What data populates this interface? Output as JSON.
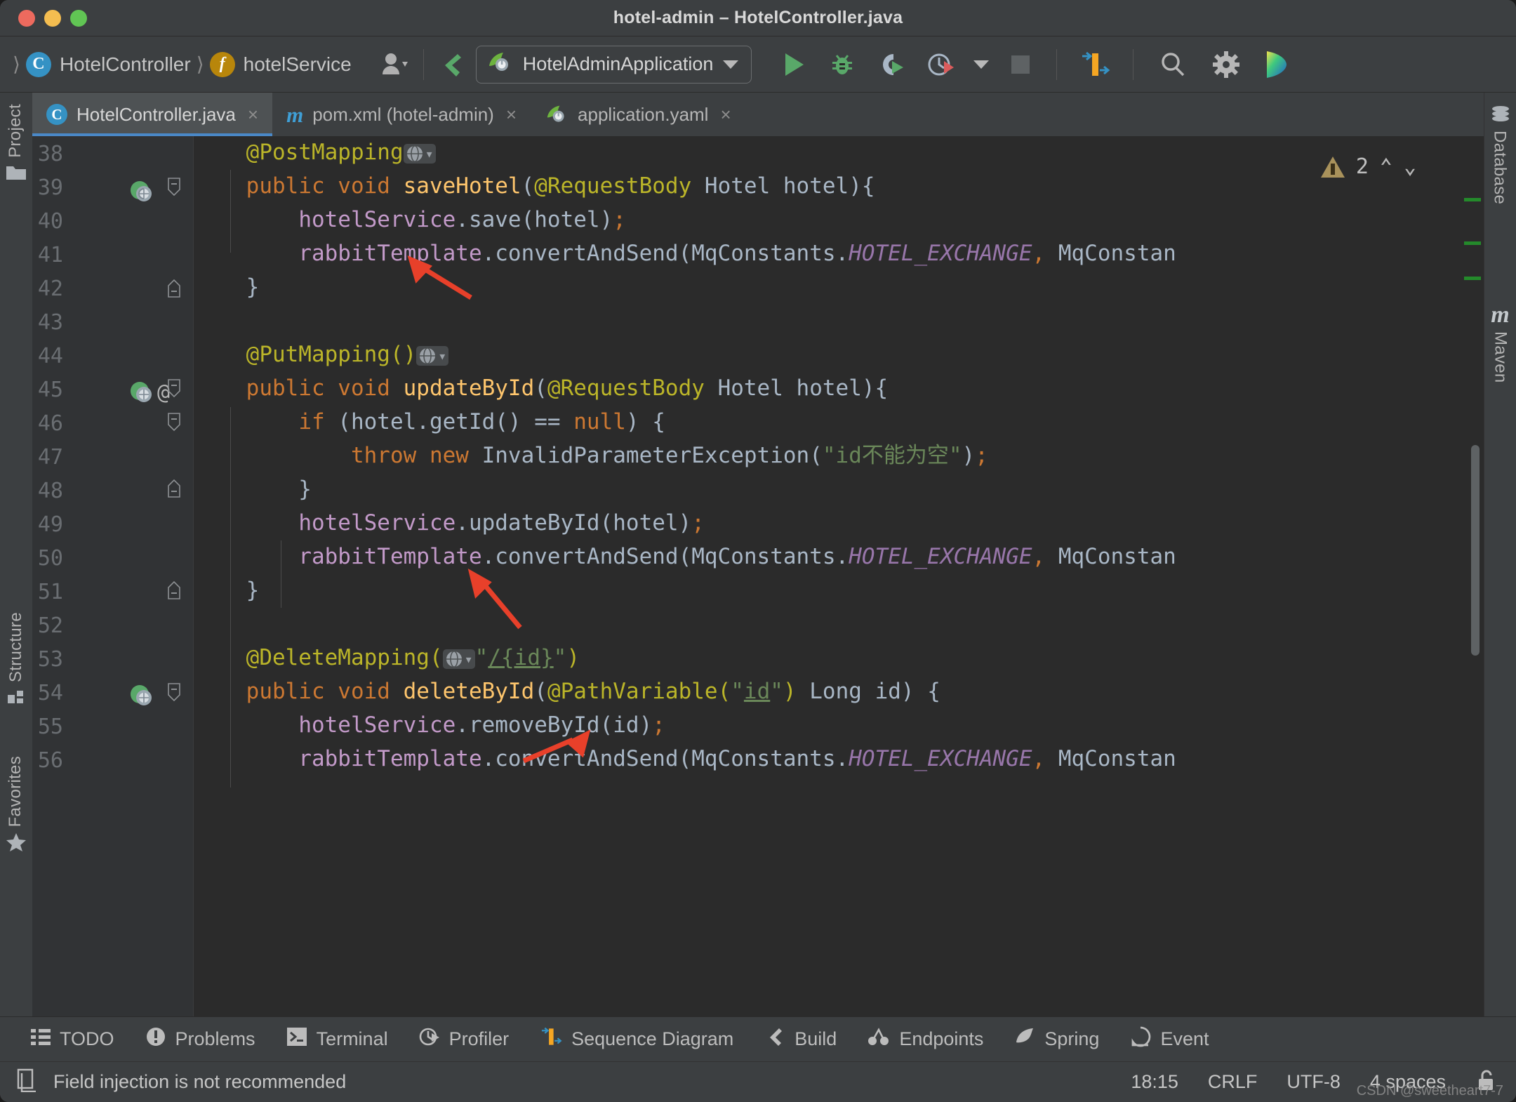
{
  "window": {
    "title": "hotel-admin – HotelController.java",
    "traffic": [
      "close",
      "minimize",
      "zoom"
    ]
  },
  "toolbar": {
    "breadcrumbs": [
      {
        "icon": "class-icon",
        "badge": "C",
        "label": "HotelController"
      },
      {
        "icon": "field-icon",
        "badge": "f",
        "label": "hotelService"
      }
    ],
    "profile_icon": "user-profile-icon",
    "update_icon": "vcs-update-icon",
    "run_config": {
      "icon": "spring-boot-icon",
      "label": "HotelAdminApplication"
    },
    "actions": [
      {
        "name": "run-button",
        "icon": "run-icon"
      },
      {
        "name": "debug-button",
        "icon": "debug-icon"
      },
      {
        "name": "run-coverage-button",
        "icon": "coverage-icon"
      },
      {
        "name": "profile-button",
        "icon": "profiler-icon"
      },
      {
        "name": "stop-button",
        "icon": "stop-icon"
      },
      {
        "name": "sequence-diagram-button",
        "icon": "sequence-diagram-icon"
      },
      {
        "name": "search-everywhere-button",
        "icon": "search-icon"
      },
      {
        "name": "settings-button",
        "icon": "gear-icon"
      },
      {
        "name": "ai-assistant-button",
        "icon": "ai-assistant-icon"
      }
    ]
  },
  "tabs": [
    {
      "label": "HotelController.java",
      "icon": "java-class-icon",
      "active": true,
      "close": "×"
    },
    {
      "label": "pom.xml (hotel-admin)",
      "icon": "maven-icon",
      "active": false,
      "close": "×"
    },
    {
      "label": "application.yaml",
      "icon": "spring-yaml-icon",
      "active": false,
      "close": "×"
    }
  ],
  "left_stripe": [
    {
      "label": "Project",
      "icon": "project-folder-icon"
    },
    {
      "label": "Structure",
      "icon": "structure-icon"
    },
    {
      "label": "Favorites",
      "icon": "star-icon"
    }
  ],
  "right_stripe": [
    {
      "label": "Database",
      "icon": "database-icon"
    },
    {
      "label": "Maven",
      "icon": "maven-m-icon"
    }
  ],
  "editor": {
    "inspection": {
      "count": "2",
      "icon": "warning-triangle-icon",
      "prev": "⌃",
      "next": "⌄"
    },
    "line_numbers": [
      "38",
      "39",
      "40",
      "41",
      "42",
      "43",
      "44",
      "45",
      "46",
      "47",
      "48",
      "49",
      "50",
      "51",
      "52",
      "53",
      "54",
      "55",
      "56"
    ],
    "gutter_icons": [
      {
        "line": "39",
        "icon": "spring-endpoint-icon"
      },
      {
        "line": "45",
        "icon": "spring-endpoint-icon"
      },
      {
        "line": "45",
        "icon": "annotation-at-icon",
        "glyph": "@"
      },
      {
        "line": "54",
        "icon": "spring-endpoint-icon"
      }
    ],
    "code_lines": [
      {
        "n": "38",
        "tokens": [
          {
            "t": "    @PostMapping",
            "c": "anno"
          },
          {
            "t": "GLOBE",
            "c": "globe"
          }
        ]
      },
      {
        "n": "39",
        "tokens": [
          {
            "t": "    ",
            "c": "punct"
          },
          {
            "t": "public void ",
            "c": "kw"
          },
          {
            "t": "saveHotel",
            "c": "meth"
          },
          {
            "t": "(",
            "c": "punct"
          },
          {
            "t": "@RequestBody",
            "c": "anno"
          },
          {
            "t": " Hotel hotel)",
            "c": "ident"
          },
          {
            "t": "{",
            "c": "punct"
          }
        ]
      },
      {
        "n": "40",
        "tokens": [
          {
            "t": "        ",
            "c": "punct"
          },
          {
            "t": "hotelService",
            "c": "field"
          },
          {
            "t": ".save(hotel)",
            "c": "ident"
          },
          {
            "t": ";",
            "c": "semi"
          }
        ]
      },
      {
        "n": "41",
        "tokens": [
          {
            "t": "        ",
            "c": "punct"
          },
          {
            "t": "rabbitTemplate",
            "c": "field"
          },
          {
            "t": ".convertAndSend(MqConstants.",
            "c": "ident"
          },
          {
            "t": "HOTEL_EXCHANGE",
            "c": "stat"
          },
          {
            "t": ",",
            "c": "semi"
          },
          {
            "t": " MqConstan",
            "c": "ident"
          }
        ]
      },
      {
        "n": "42",
        "tokens": [
          {
            "t": "    }",
            "c": "punct"
          }
        ]
      },
      {
        "n": "43",
        "tokens": []
      },
      {
        "n": "44",
        "tokens": [
          {
            "t": "    @PutMapping()",
            "c": "anno"
          },
          {
            "t": "GLOBE",
            "c": "globe"
          }
        ]
      },
      {
        "n": "45",
        "tokens": [
          {
            "t": "    ",
            "c": "punct"
          },
          {
            "t": "public void ",
            "c": "kw"
          },
          {
            "t": "updateById",
            "c": "meth"
          },
          {
            "t": "(",
            "c": "punct"
          },
          {
            "t": "@RequestBody",
            "c": "anno"
          },
          {
            "t": " Hotel hotel)",
            "c": "ident"
          },
          {
            "t": "{",
            "c": "punct"
          }
        ]
      },
      {
        "n": "46",
        "tokens": [
          {
            "t": "        ",
            "c": "punct"
          },
          {
            "t": "if",
            "c": "kw"
          },
          {
            "t": " (hotel.getId() == ",
            "c": "ident"
          },
          {
            "t": "null",
            "c": "kw"
          },
          {
            "t": ") {",
            "c": "ident"
          }
        ]
      },
      {
        "n": "47",
        "tokens": [
          {
            "t": "            ",
            "c": "punct"
          },
          {
            "t": "throw new ",
            "c": "kw"
          },
          {
            "t": "InvalidParameterException(",
            "c": "ident"
          },
          {
            "t": "\"id不能为空\"",
            "c": "str"
          },
          {
            "t": ")",
            "c": "ident"
          },
          {
            "t": ";",
            "c": "semi"
          }
        ]
      },
      {
        "n": "48",
        "tokens": [
          {
            "t": "        }",
            "c": "punct"
          }
        ]
      },
      {
        "n": "49",
        "tokens": [
          {
            "t": "        ",
            "c": "punct"
          },
          {
            "t": "hotelService",
            "c": "field"
          },
          {
            "t": ".updateById(hotel)",
            "c": "ident"
          },
          {
            "t": ";",
            "c": "semi"
          }
        ]
      },
      {
        "n": "50",
        "tokens": [
          {
            "t": "        ",
            "c": "punct"
          },
          {
            "t": "rabbitTemplate",
            "c": "field"
          },
          {
            "t": ".convertAndSend(MqConstants.",
            "c": "ident"
          },
          {
            "t": "HOTEL_EXCHANGE",
            "c": "stat"
          },
          {
            "t": ",",
            "c": "semi"
          },
          {
            "t": " MqConstan",
            "c": "ident"
          }
        ]
      },
      {
        "n": "51",
        "tokens": [
          {
            "t": "    }",
            "c": "punct"
          }
        ]
      },
      {
        "n": "52",
        "tokens": []
      },
      {
        "n": "53",
        "tokens": [
          {
            "t": "    @DeleteMapping(",
            "c": "anno"
          },
          {
            "t": "GLOBE",
            "c": "globe"
          },
          {
            "t": "\"",
            "c": "str"
          },
          {
            "t": "/{id}",
            "c": "url"
          },
          {
            "t": "\"",
            "c": "str"
          },
          {
            "t": ")",
            "c": "anno"
          }
        ]
      },
      {
        "n": "54",
        "tokens": [
          {
            "t": "    ",
            "c": "punct"
          },
          {
            "t": "public void ",
            "c": "kw"
          },
          {
            "t": "deleteById",
            "c": "meth"
          },
          {
            "t": "(",
            "c": "punct"
          },
          {
            "t": "@PathVariable",
            "c": "anno"
          },
          {
            "t": "(",
            "c": "anno"
          },
          {
            "t": "\"",
            "c": "str"
          },
          {
            "t": "id",
            "c": "uid"
          },
          {
            "t": "\"",
            "c": "str"
          },
          {
            "t": ")",
            "c": "anno"
          },
          {
            "t": " Long id) {",
            "c": "ident"
          }
        ]
      },
      {
        "n": "55",
        "tokens": [
          {
            "t": "        ",
            "c": "punct"
          },
          {
            "t": "hotelService",
            "c": "field"
          },
          {
            "t": ".removeById(id)",
            "c": "ident"
          },
          {
            "t": ";",
            "c": "semi"
          }
        ]
      },
      {
        "n": "56",
        "tokens": [
          {
            "t": "        ",
            "c": "punct"
          },
          {
            "t": "rabbitTemplate",
            "c": "field"
          },
          {
            "t": ".convertAndSend(MqConstants.",
            "c": "ident"
          },
          {
            "t": "HOTEL_EXCHANGE",
            "c": "stat"
          },
          {
            "t": ",",
            "c": "semi"
          },
          {
            "t": " MqConstan",
            "c": "ident"
          }
        ]
      }
    ],
    "annotations": [
      {
        "name": "red-arrow-1"
      },
      {
        "name": "red-arrow-2"
      },
      {
        "name": "red-arrow-3"
      }
    ]
  },
  "bottom_tools": [
    {
      "label": "TODO",
      "icon": "todo-list-icon"
    },
    {
      "label": "Problems",
      "icon": "problems-icon"
    },
    {
      "label": "Terminal",
      "icon": "terminal-icon"
    },
    {
      "label": "Profiler",
      "icon": "profiler-icon"
    },
    {
      "label": "Sequence Diagram",
      "icon": "sequence-diagram-icon"
    },
    {
      "label": "Build",
      "icon": "build-hammer-icon"
    },
    {
      "label": "Endpoints",
      "icon": "endpoints-icon"
    },
    {
      "label": "Spring",
      "icon": "spring-leaf-icon"
    },
    {
      "label": "Event",
      "icon": "event-log-icon"
    }
  ],
  "statusbar": {
    "message": "Field injection is not recommended",
    "memory_icon": "document-icon",
    "time": "18:15",
    "line_separator": "CRLF",
    "encoding": "UTF-8",
    "indent": "4 spaces",
    "lock_icon": "unlocked-padlock-icon",
    "watermark": "CSDN @sweetheart7-7"
  },
  "colors": {
    "accent_blue": "#4a88c7",
    "keyword_orange": "#cc7832",
    "method_yellow": "#ffc66d",
    "annotation_yellow": "#bbb529",
    "field_purple": "#c39ac9",
    "static_purple": "#9876aa",
    "string_green": "#6a8759",
    "editor_bg": "#2b2b2b",
    "chrome_bg": "#3c3f41",
    "arrow_red": "#e8402a"
  }
}
